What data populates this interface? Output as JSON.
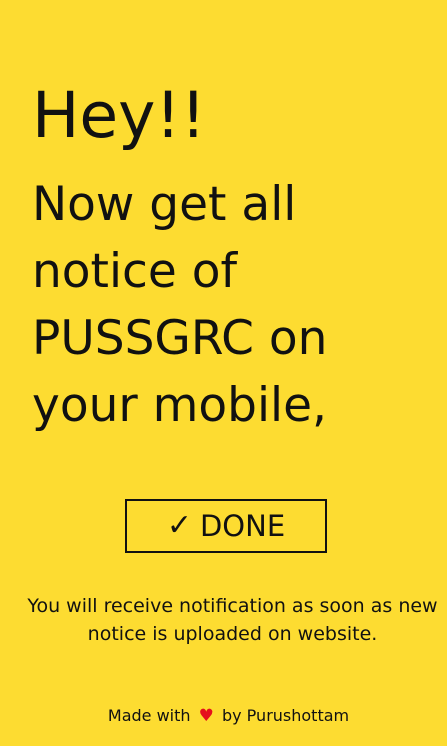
{
  "greeting": "Hey!!",
  "headline": "Now get all notice of PUSSGRC on your mobile,",
  "done_button": {
    "check_icon": "✓",
    "label": "DONE"
  },
  "info_text": "You will receive notification as soon as new notice is uploaded on website.",
  "footer": {
    "prefix": "Made with",
    "heart_icon": "♥",
    "suffix": "by Purushottam"
  },
  "colors": {
    "background": "#fddc31",
    "text": "#111111",
    "heart": "#e5101c"
  }
}
